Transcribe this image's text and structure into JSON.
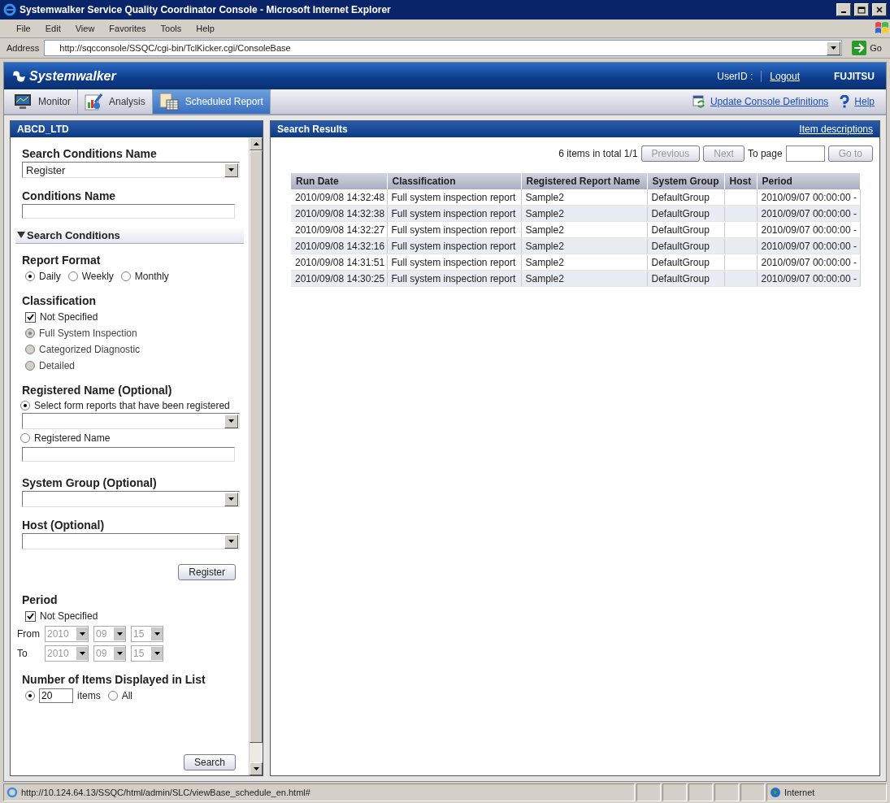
{
  "window": {
    "title": "Systemwalker Service Quality Coordinator Console - Microsoft Internet Explorer"
  },
  "menu": [
    "File",
    "Edit",
    "View",
    "Favorites",
    "Tools",
    "Help"
  ],
  "address": {
    "label": "Address",
    "value": "http://sqcconsole/SSQC/cgi-bin/TclKicker.cgi/ConsoleBase",
    "go": "Go"
  },
  "header": {
    "brand": "Systemwalker",
    "user_label": "UserID :",
    "logout": "Logout",
    "vendor": "FUJITSU"
  },
  "tabs": [
    {
      "label": "Monitor",
      "selected": false
    },
    {
      "label": "Analysis",
      "selected": false
    },
    {
      "label": "Scheduled Report",
      "selected": true
    }
  ],
  "header_links": [
    {
      "label": "Update Console Definitions"
    },
    {
      "label": "Help"
    }
  ],
  "left_panel": {
    "title": "ABCD_LTD",
    "search_conditions_name": {
      "label": "Search Conditions Name",
      "value": "Register"
    },
    "conditions_name": {
      "label": "Conditions Name"
    },
    "search_conditions": {
      "label": "Search Conditions",
      "expanded": true
    },
    "report_format": {
      "label": "Report Format",
      "options": [
        {
          "label": "Daily",
          "selected": true
        },
        {
          "label": "Weekly",
          "selected": false
        },
        {
          "label": "Monthly",
          "selected": false
        }
      ]
    },
    "classification": {
      "label": "Classification",
      "not_specified": {
        "label": "Not Specified",
        "checked": true
      },
      "options": [
        {
          "label": "Full System Inspection",
          "selected": true
        },
        {
          "label": "Categorized Diagnostic",
          "selected": false
        },
        {
          "label": "Detailed",
          "selected": false
        }
      ],
      "disabled": true
    },
    "registered_name": {
      "label": "Registered Name (Optional)",
      "options": [
        {
          "label": "Select form reports that have been registered",
          "selected": true
        },
        {
          "label": "Registered Name",
          "selected": false
        }
      ]
    },
    "system_group": {
      "label": "System Group (Optional)"
    },
    "host": {
      "label": "Host (Optional)"
    },
    "register_button": "Register",
    "period": {
      "label": "Period",
      "not_specified": {
        "label": "Not Specified",
        "checked": true
      },
      "disabled": true,
      "rows": [
        {
          "label": "From",
          "year": "2010",
          "month": "09",
          "day": "15"
        },
        {
          "label": "To",
          "year": "2010",
          "month": "09",
          "day": "15"
        }
      ]
    },
    "items_count": {
      "label": "Number of Items Displayed in List",
      "count_selected": true,
      "count": "20",
      "unit": "items",
      "all_label": "All",
      "all_selected": false
    },
    "search_button": "Search"
  },
  "results": {
    "title": "Search Results",
    "link": "Item descriptions",
    "summary": "6 items in total 1/1",
    "previous": "Previous",
    "next": "Next",
    "to_page": "To page",
    "go_to": "Go to",
    "pager_disabled": true,
    "columns": [
      "Run Date",
      "Classification",
      "Registered Report Name",
      "System Group",
      "Host",
      "Period"
    ],
    "rows": [
      [
        "2010/09/08 14:32:48",
        "Full system inspection report",
        "Sample2",
        "DefaultGroup",
        "",
        "2010/09/07 00:00:00 -"
      ],
      [
        "2010/09/08 14:32:38",
        "Full system inspection report",
        "Sample2",
        "DefaultGroup",
        "",
        "2010/09/07 00:00:00 -"
      ],
      [
        "2010/09/08 14:32:27",
        "Full system inspection report",
        "Sample2",
        "DefaultGroup",
        "",
        "2010/09/07 00:00:00 -"
      ],
      [
        "2010/09/08 14:32:16",
        "Full system inspection report",
        "Sample2",
        "DefaultGroup",
        "",
        "2010/09/07 00:00:00 -"
      ],
      [
        "2010/09/08 14:31:51",
        "Full system inspection report",
        "Sample2",
        "DefaultGroup",
        "",
        "2010/09/07 00:00:00 -"
      ],
      [
        "2010/09/08 14:30:25",
        "Full system inspection report",
        "Sample2",
        "DefaultGroup",
        "",
        "2010/09/07 00:00:00 -"
      ]
    ]
  },
  "status_bar": {
    "url": "http://10.124.64.13/SSQC/html/admin/SLC/viewBase_schedule_en.html#",
    "zone": "Internet"
  }
}
